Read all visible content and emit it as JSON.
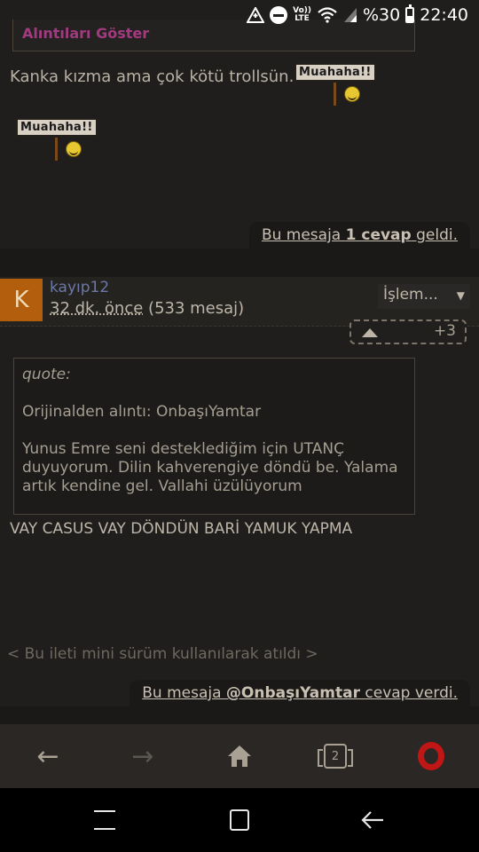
{
  "status_bar": {
    "battery_percent": "%30",
    "time": "22:40",
    "icons": [
      "data-saver-icon",
      "dnd-icon",
      "volte-icon",
      "wifi-icon",
      "signal-icon",
      "battery-icon"
    ],
    "volte_label": "Vo)) LTE"
  },
  "prev_post": {
    "quote_toggle": "Alıntıları Göster",
    "text": "Kanka kızma ama çok kötü trollsün.",
    "smiley_label": "Muahaha!!",
    "reply_notice": {
      "prefix": "Bu mesaja ",
      "count": "1 cevap",
      "suffix": " geldi."
    }
  },
  "post": {
    "avatar_letter": "K",
    "username": "kayıp12",
    "time_ago": "32 dk. önce",
    "message_count": "(533 mesaj)",
    "action_select": "İşlem...",
    "vote_score": "+3",
    "quote": {
      "label": "quote:",
      "source": "Orijinalden alıntı: OnbaşıYamtar",
      "text": "Yunus Emre seni desteklediğim için UTANÇ duyuyorum. Dilin kahverengiye döndü be. Yalama artık kendine gel. Vallahi üzülüyorum"
    },
    "body": "VAY CASUS VAY DÖNDÜN BARİ YAMUK YAPMA",
    "mini_note": "< Bu ileti mini sürüm kullanılarak atıldı >",
    "reply_notice": {
      "prefix": "Bu mesaja ",
      "user": "@OnbaşıYamtar",
      "suffix": " cevap verdi."
    }
  },
  "toolbar": {
    "back": "←",
    "forward": "→",
    "tab_count": "2"
  },
  "colors": {
    "background": "#1f1e1c",
    "avatar": "#b35e0c",
    "username": "#6c78a8",
    "opera_red": "#c01616"
  }
}
